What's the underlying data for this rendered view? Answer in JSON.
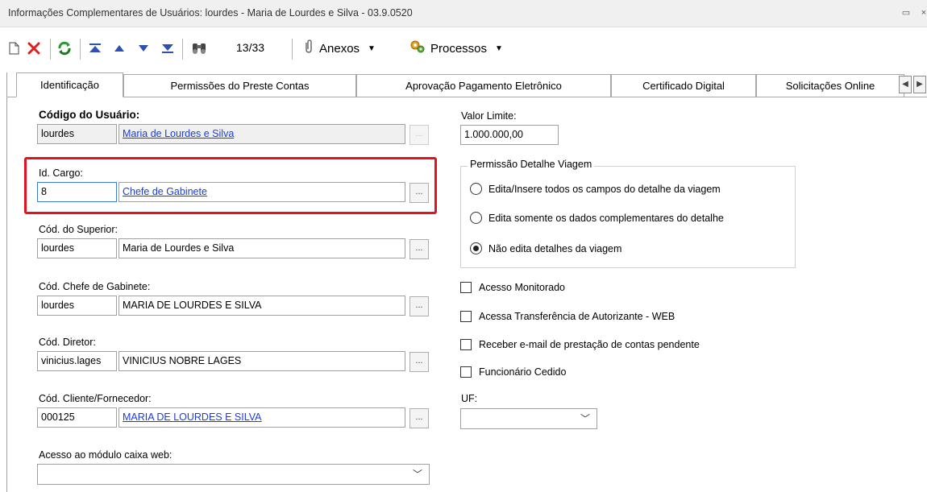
{
  "window": {
    "title": "Informações Complementares de Usuários: lourdes - Maria de Lourdes e Silva - 03.9.0520"
  },
  "toolbar": {
    "counter": "13/33",
    "anexos_label": "Anexos",
    "processos_label": "Processos"
  },
  "tabs": [
    {
      "label": "Identificação"
    },
    {
      "label": "Permissões do Preste Contas"
    },
    {
      "label": "Aprovação Pagamento Eletrônico"
    },
    {
      "label": "Certificado Digital"
    },
    {
      "label": "Solicitações Online"
    }
  ],
  "form": {
    "codigo_usuario": {
      "label": "Código do Usuário:",
      "code": "lourdes",
      "name": "Maria de Lourdes e Silva"
    },
    "id_cargo": {
      "label": "Id. Cargo:",
      "code": "8",
      "name": "Chefe de Gabinete"
    },
    "cod_superior": {
      "label": "Cód. do Superior:",
      "code": "lourdes",
      "name": "Maria de Lourdes e Silva"
    },
    "cod_chefe_gabinete": {
      "label": "Cód. Chefe de Gabinete:",
      "code": "lourdes",
      "name": "MARIA DE LOURDES E SILVA"
    },
    "cod_diretor": {
      "label": "Cód. Diretor:",
      "code": "vinicius.lages",
      "name": "VINICIUS NOBRE LAGES"
    },
    "cod_cliente": {
      "label": "Cód. Cliente/Fornecedor:",
      "code": "000125",
      "name": "MARIA DE LOURDES E SILVA"
    },
    "acesso_caixa": {
      "label": "Acesso ao módulo caixa web:",
      "value": ""
    },
    "lookup_button": "...",
    "valor_limite": {
      "label": "Valor Limite:",
      "value": "1.000.000,00"
    },
    "permissao_viagem": {
      "title": "Permissão Detalhe Viagem",
      "options": [
        {
          "label": "Edita/Insere todos os campos do detalhe da viagem",
          "selected": false
        },
        {
          "label": "Edita somente os dados complementares do detalhe",
          "selected": false
        },
        {
          "label": "Não edita detalhes da viagem",
          "selected": true
        }
      ]
    },
    "checkboxes": [
      {
        "label": "Acesso Monitorado",
        "checked": false
      },
      {
        "label": "Acessa Transferência de Autorizante - WEB",
        "checked": false
      },
      {
        "label": "Receber e-mail de prestação de contas pendente",
        "checked": false
      },
      {
        "label": "Funcionário Cedido",
        "checked": false
      }
    ],
    "uf": {
      "label": "UF:",
      "value": ""
    }
  },
  "colors": {
    "highlight": "#e0141e",
    "link": "#1a3ce0"
  }
}
